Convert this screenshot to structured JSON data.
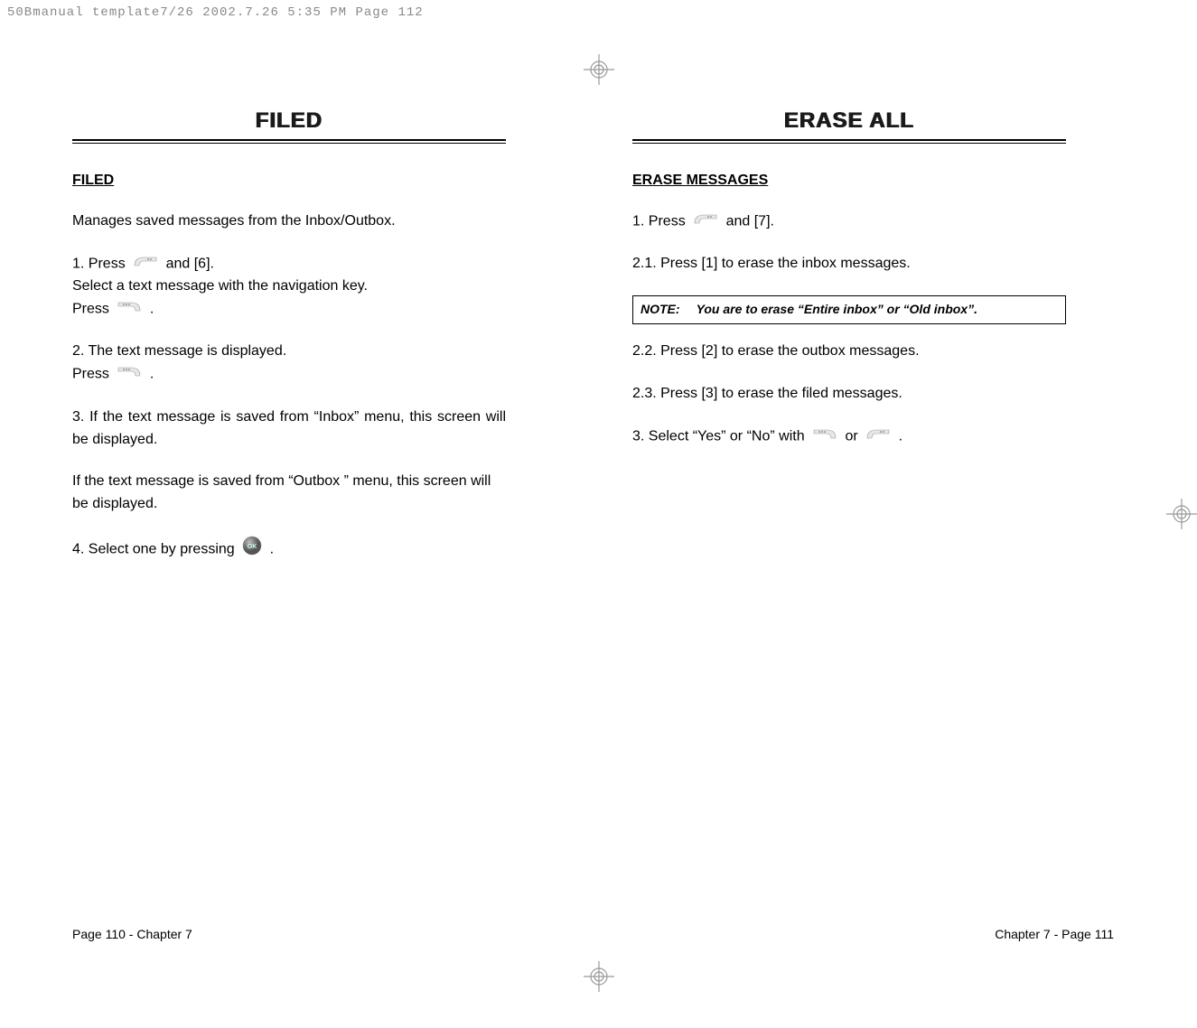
{
  "imposition_header": "50Bmanual template7/26  2002.7.26  5:35 PM  Page 112",
  "left": {
    "title": "FILED",
    "heading": "FILED",
    "intro": "Manages saved messages from the Inbox/Outbox.",
    "step1a": "1. Press",
    "step1b": "and [6].",
    "step1c": "Select a text message with the navigation key.",
    "step1d": "Press",
    "step1e": ".",
    "step2a": "2. The text message is displayed.",
    "step2b": "Press",
    "step2c": ".",
    "step3": "3. If the text message is saved from “Inbox” menu, this screen will be displayed.",
    "step3b": "If the text message is saved from “Outbox ” menu, this screen will be displayed.",
    "step4a": "4. Select one by pressing",
    "step4b": ".",
    "footer": "Page 110 - Chapter 7"
  },
  "right": {
    "title": "ERASE ALL",
    "heading": "ERASE MESSAGES",
    "step1a": "1. Press",
    "step1b": "and [7].",
    "step21": "2.1. Press [1] to erase the inbox messages.",
    "note_label": "NOTE:",
    "note_text": "You are to erase “Entire inbox” or “Old inbox”.",
    "step22": "2.2. Press [2] to erase the outbox messages.",
    "step23": "2.3. Press [3] to erase the filed messages.",
    "step3a": "3. Select “Yes” or “No” with",
    "step3b": "or",
    "step3c": ".",
    "footer": "Chapter 7 - Page 111"
  },
  "icons": {
    "soft_right": "soft-right-icon",
    "soft_left": "soft-left-icon",
    "ok": "ok-icon"
  }
}
